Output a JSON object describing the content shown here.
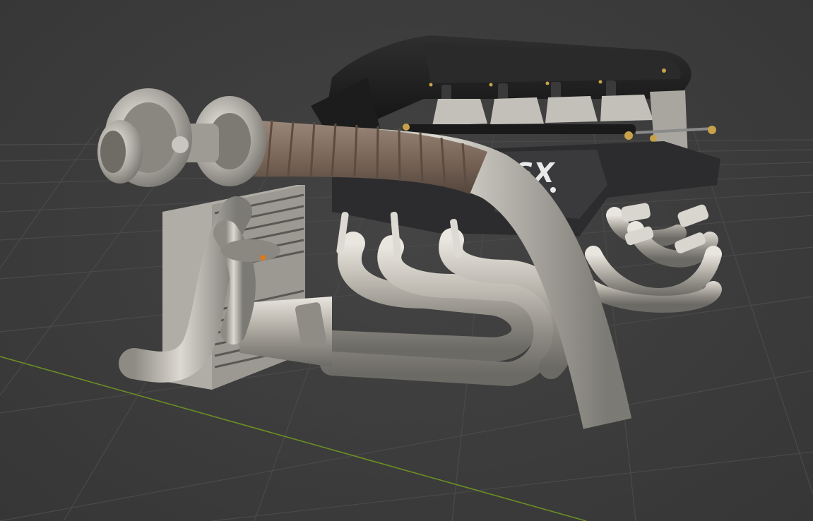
{
  "viewport": {
    "background_color": "#3d3d3d",
    "grid_line_color": "#4a4a4a",
    "x_axis_color": "#6b8e23"
  },
  "model": {
    "badge_text": "SX",
    "colors": {
      "metal": "#b9b6ae",
      "intake_manifold": "#1d1d1d",
      "heat_wrap": "#7e6b5c",
      "engine_block": "#2c2c2e",
      "fittings": "#c8a24a",
      "sensor_dot": "#e0781e"
    }
  }
}
